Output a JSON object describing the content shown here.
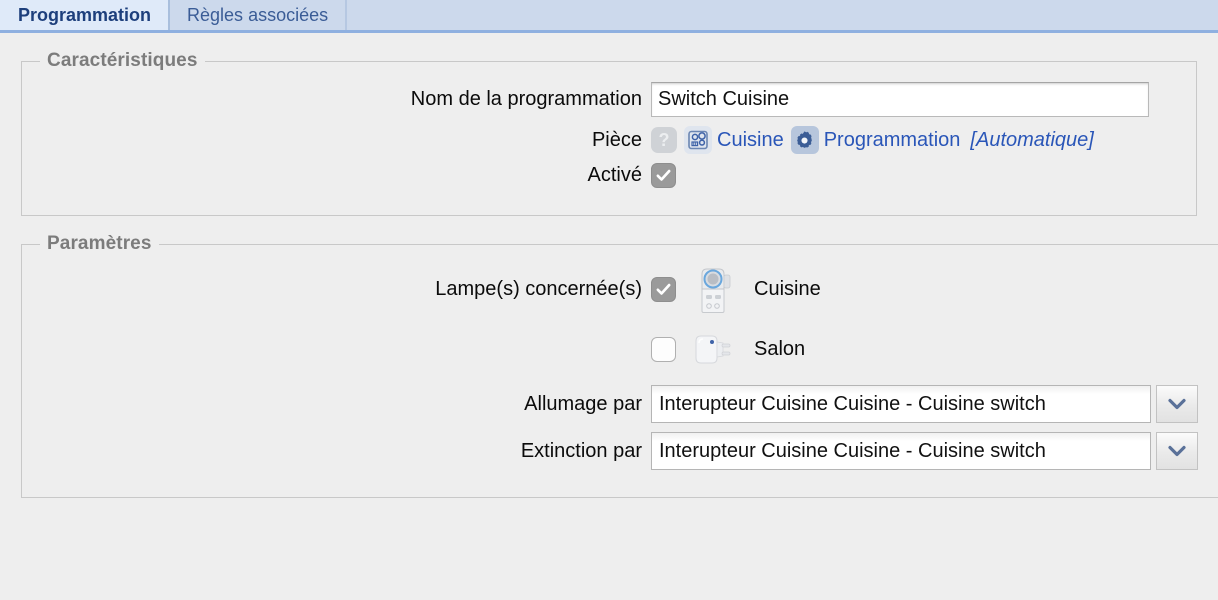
{
  "tabs": [
    {
      "label": "Programmation",
      "active": true
    },
    {
      "label": "Règles associées",
      "active": false
    }
  ],
  "sections": {
    "caracteristiques": {
      "legend": "Caractéristiques",
      "name_row": {
        "label": "Nom de la programmation",
        "value": "Switch Cuisine",
        "placeholder": ""
      },
      "piece_row": {
        "label": "Pièce",
        "help_icon": "help-icon",
        "room_icon": "cooktop-icon",
        "room_label": "Cuisine",
        "category_icon": "gear-icon",
        "category_label": "Programmation",
        "mode_note": "[Automatique]"
      },
      "active_row": {
        "label": "Activé",
        "checked": true
      }
    },
    "parametres": {
      "legend": "Paramètres",
      "lamps_row": {
        "label": "Lampe(s) concernée(s)",
        "devices": [
          {
            "name": "Cuisine",
            "checked": true,
            "icon": "smart-plug-icon"
          },
          {
            "name": "Salon",
            "checked": false,
            "icon": "smart-plug-icon"
          }
        ]
      },
      "allumage_row": {
        "label": "Allumage par",
        "value": "Interupteur Cuisine Cuisine - Cuisine switch"
      },
      "extinction_row": {
        "label": "Extinction par",
        "value": "Interupteur Cuisine Cuisine - Cuisine switch"
      }
    }
  },
  "colors": {
    "tab_active_bg": "#dfeaf9",
    "tab_inactive_bg": "#ccd9ec",
    "tab_underline": "#8fb0e0",
    "link_blue": "#2a56b8",
    "legend_grey": "#7c7c7c",
    "page_bg": "#eeeeee"
  }
}
